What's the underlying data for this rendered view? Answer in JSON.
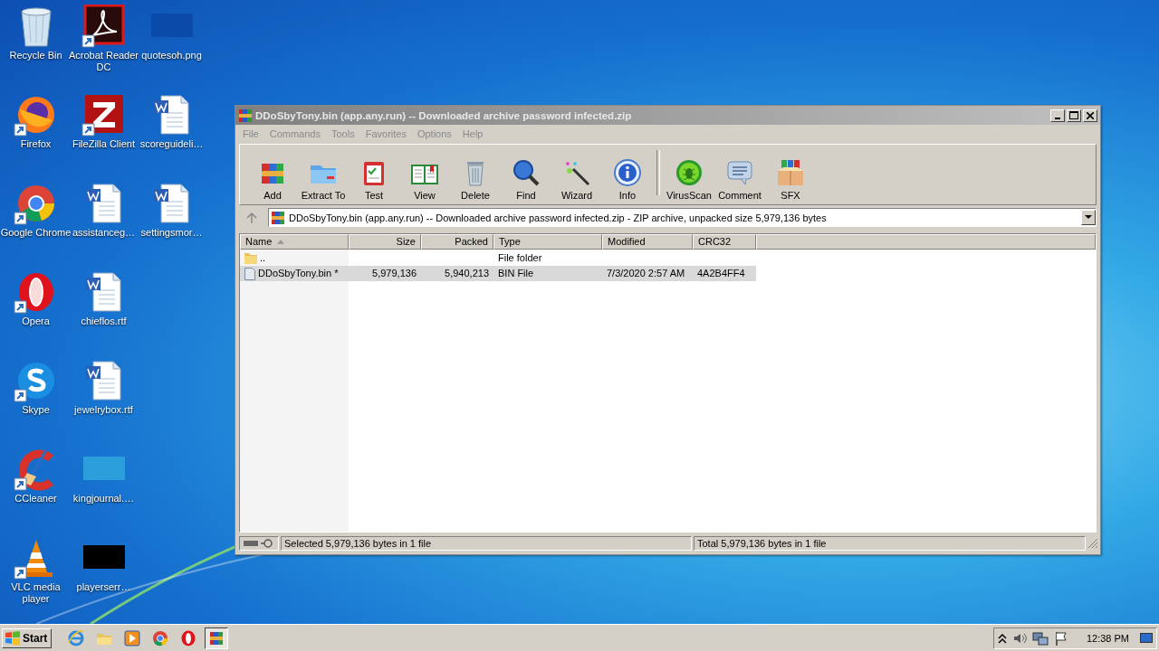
{
  "desktop_icons": [
    {
      "label": "Recycle Bin",
      "kind": "recycle",
      "shortcut": false
    },
    {
      "label": "Firefox",
      "kind": "firefox",
      "shortcut": true
    },
    {
      "label": "Google Chrome",
      "kind": "chrome",
      "shortcut": true
    },
    {
      "label": "Opera",
      "kind": "opera",
      "shortcut": true
    },
    {
      "label": "Skype",
      "kind": "skype",
      "shortcut": true
    },
    {
      "label": "CCleaner",
      "kind": "ccleaner",
      "shortcut": true
    },
    {
      "label": "VLC media player",
      "kind": "vlc",
      "shortcut": true
    },
    {
      "label": "Acrobat Reader DC",
      "kind": "acrobat",
      "shortcut": true
    },
    {
      "label": "FileZilla Client",
      "kind": "filezilla",
      "shortcut": true
    },
    {
      "label": "assistanceg…",
      "kind": "word",
      "shortcut": false
    },
    {
      "label": "chieflos.rtf",
      "kind": "word",
      "shortcut": false
    },
    {
      "label": "jewelrybox.rtf",
      "kind": "word",
      "shortcut": false
    },
    {
      "label": "kingjournal.…",
      "kind": "thumbnail",
      "color": "#2b9fdc",
      "shortcut": false
    },
    {
      "label": "playerserr…",
      "kind": "thumbnail",
      "color": "#000000",
      "shortcut": false
    },
    {
      "label": "quotesoh.png",
      "kind": "thumbnail",
      "color": "#0b4aa8",
      "shortcut": false
    },
    {
      "label": "scoreguideli…",
      "kind": "word",
      "shortcut": false
    },
    {
      "label": "settingsmor…",
      "kind": "word",
      "shortcut": false
    }
  ],
  "window": {
    "title": "DDoSbyTony.bin (app.any.run) -- Downloaded archive password infected.zip",
    "active": false,
    "menu": [
      "File",
      "Commands",
      "Tools",
      "Favorites",
      "Options",
      "Help"
    ],
    "toolbar": [
      [
        {
          "label": "Add",
          "kind": "add"
        },
        {
          "label": "Extract To",
          "kind": "extract"
        },
        {
          "label": "Test",
          "kind": "test"
        },
        {
          "label": "View",
          "kind": "view"
        },
        {
          "label": "Delete",
          "kind": "delete"
        },
        {
          "label": "Find",
          "kind": "find"
        },
        {
          "label": "Wizard",
          "kind": "wizard"
        },
        {
          "label": "Info",
          "kind": "info"
        }
      ],
      [
        {
          "label": "VirusScan",
          "kind": "virusscan"
        },
        {
          "label": "Comment",
          "kind": "comment"
        },
        {
          "label": "SFX",
          "kind": "sfx"
        }
      ]
    ],
    "address": "DDoSbyTony.bin (app.any.run) -- Downloaded archive password infected.zip - ZIP archive, unpacked size 5,979,136 bytes",
    "columns": [
      {
        "label": "Name",
        "sorted": true
      },
      {
        "label": "Size",
        "sorted": false
      },
      {
        "label": "Packed",
        "sorted": false
      },
      {
        "label": "Type",
        "sorted": false
      },
      {
        "label": "Modified",
        "sorted": false
      },
      {
        "label": "CRC32",
        "sorted": false
      }
    ],
    "rows": [
      {
        "kind": "folder",
        "selected": false,
        "cells": [
          "..",
          "",
          "",
          "File folder",
          "",
          ""
        ]
      },
      {
        "kind": "file",
        "selected": true,
        "cells": [
          "DDoSbyTony.bin *",
          "5,979,136",
          "5,940,213",
          "BIN File",
          "7/3/2020 2:57 AM",
          "4A2B4FF4"
        ]
      }
    ],
    "status_left": "Selected 5,979,136 bytes in 1 file",
    "status_right": "Total 5,979,136 bytes in 1 file"
  },
  "taskbar": {
    "start": "Start",
    "apps": [
      {
        "kind": "ie",
        "active": false
      },
      {
        "kind": "explorer",
        "active": false
      },
      {
        "kind": "mediaplayer",
        "active": false
      },
      {
        "kind": "chrome",
        "active": false
      },
      {
        "kind": "opera",
        "active": false
      },
      {
        "kind": "winrar",
        "active": true
      }
    ],
    "clock": "12:38 PM"
  }
}
